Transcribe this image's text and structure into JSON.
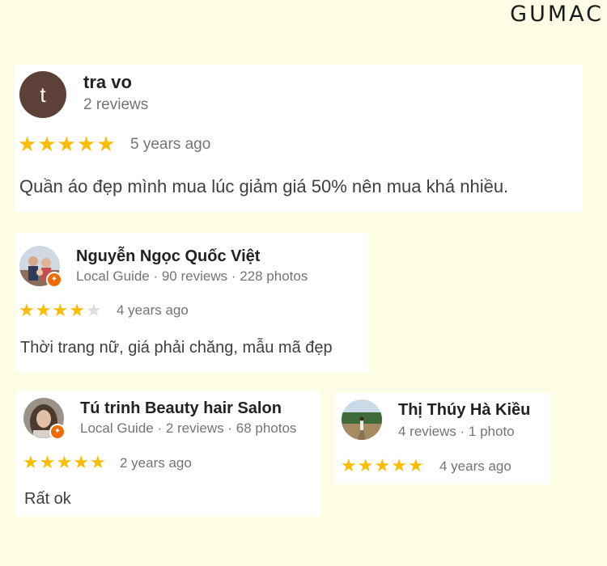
{
  "brand": "GUMAC",
  "colors": {
    "star_on": "#fbbc04",
    "star_off": "#dadce0",
    "background": "#fdfde6",
    "badge": "#ef6c00"
  },
  "reviews": [
    {
      "name": "tra vo",
      "avatar_letter": "t",
      "meta": "2 reviews",
      "rating": 5,
      "ago": "5 years ago",
      "text": "Quần áo đẹp mình mua lúc giảm giá 50% nên mua khá nhiều."
    },
    {
      "name": "Nguyễn Ngọc Quốc Việt",
      "avatar_icon": "family-photo-avatar",
      "local_guide_badge": "local-guide-badge-icon",
      "meta": "Local Guide · 90 reviews · 228 photos",
      "rating": 4,
      "ago": "4 years ago",
      "text": "Thời trang nữ, giá phải chăng, mẫu mã đẹp"
    },
    {
      "name": "Tú trinh Beauty hair Salon",
      "avatar_icon": "portrait-photo-avatar",
      "local_guide_badge": "local-guide-badge-icon",
      "meta": "Local Guide · 2 reviews · 68 photos",
      "rating": 5,
      "ago": "2 years ago",
      "text": "Rất ok"
    },
    {
      "name": "Thị Thúy Hà Kiều",
      "avatar_icon": "landscape-photo-avatar",
      "meta": "4 reviews · 1 photo",
      "rating": 5,
      "ago": "4 years ago",
      "text": ""
    }
  ]
}
